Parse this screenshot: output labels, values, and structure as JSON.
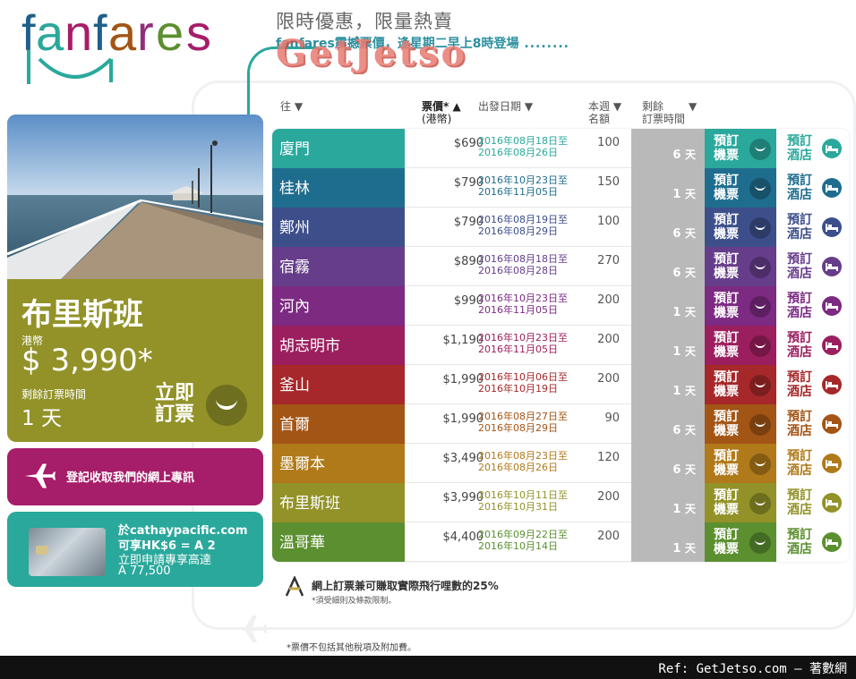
{
  "brand": {
    "logo_text": "fanfares",
    "colors": {
      "f": "#1f5f8b",
      "a": "#2aa89c",
      "n": "#a61d6a",
      "fares": "#922d7a"
    }
  },
  "header": {
    "title": "限時優惠，限量熱賣",
    "subtitle": "fanfares震撼票價，逢星期二早上8時登場",
    "watermark": "GetJetso"
  },
  "promo": {
    "city": "布里斯班",
    "currency_label": "港幣",
    "price": "$ 3,990*",
    "deadline_label": "剩餘訂票時間",
    "days": "1 天",
    "book_line1": "立即",
    "book_line2": "訂票"
  },
  "register": {
    "label": "登記收取我們的網上專訊"
  },
  "cathay": {
    "line1": "於cathaypacific.com",
    "line2": "可享HK$6 = A 2",
    "line3": "立即申請專享高達",
    "line4": "A 77,500"
  },
  "table": {
    "headers": {
      "dest": "往 ▼",
      "price1": "票價* ▲",
      "price2": "(港幣)",
      "dates": "出發日期 ▼",
      "quota1": "本週 ▼",
      "quota2": "名額",
      "remain1": "剩餘",
      "remain2": "訂票時間",
      "remain_arrow": "▼"
    },
    "fly_line1": "預訂",
    "fly_line2": "機票",
    "hotel_line1": "預訂",
    "hotel_line2": "酒店",
    "day_unit": "天",
    "rows": [
      {
        "dest": "廈門",
        "price": "$690",
        "date_from": "2016年08月18日至",
        "date_to": "2016年08月26日",
        "quota": "100",
        "days": "6",
        "color": "#2aa89c"
      },
      {
        "dest": "桂林",
        "price": "$790",
        "date_from": "2016年10月23日至",
        "date_to": "2016年11月05日",
        "quota": "150",
        "days": "1",
        "color": "#1f6d8e"
      },
      {
        "dest": "鄭州",
        "price": "$790",
        "date_from": "2016年08月19日至",
        "date_to": "2016年08月29日",
        "quota": "100",
        "days": "6",
        "color": "#3d4f8a"
      },
      {
        "dest": "宿霧",
        "price": "$890",
        "date_from": "2016年08月18日至",
        "date_to": "2016年08月28日",
        "quota": "270",
        "days": "6",
        "color": "#663d8a"
      },
      {
        "dest": "河內",
        "price": "$990",
        "date_from": "2016年10月23日至",
        "date_to": "2016年11月05日",
        "quota": "200",
        "days": "1",
        "color": "#7c2a82"
      },
      {
        "dest": "胡志明市",
        "price": "$1,190",
        "date_from": "2016年10月23日至",
        "date_to": "2016年11月05日",
        "quota": "200",
        "days": "1",
        "color": "#9b1f5e"
      },
      {
        "dest": "釜山",
        "price": "$1,990",
        "date_from": "2016年10月06日至",
        "date_to": "2016年10月19日",
        "quota": "200",
        "days": "1",
        "color": "#a6282a"
      },
      {
        "dest": "首爾",
        "price": "$1,990",
        "date_from": "2016年08月27日至",
        "date_to": "2016年08月29日",
        "quota": "90",
        "days": "6",
        "color": "#a35515"
      },
      {
        "dest": "墨爾本",
        "price": "$3,490",
        "date_from": "2016年08月23日至",
        "date_to": "2016年08月26日",
        "quota": "120",
        "days": "6",
        "color": "#b07a1a"
      },
      {
        "dest": "布里斯班",
        "price": "$3,990",
        "date_from": "2016年10月11日至",
        "date_to": "2016年10月31日",
        "quota": "200",
        "days": "1",
        "color": "#929229"
      },
      {
        "dest": "溫哥華",
        "price": "$4,400",
        "date_from": "2016年09月22日至",
        "date_to": "2016年10月14日",
        "quota": "200",
        "days": "1",
        "color": "#5b8f2f"
      }
    ]
  },
  "footer": {
    "miles": "網上訂票兼可賺取實際飛行哩數的25%",
    "terms": "*須受細則及條款限制。",
    "note": "*票價不包括其他稅項及附加費。"
  },
  "ref": "Ref: GetJetso.com – 著數網"
}
